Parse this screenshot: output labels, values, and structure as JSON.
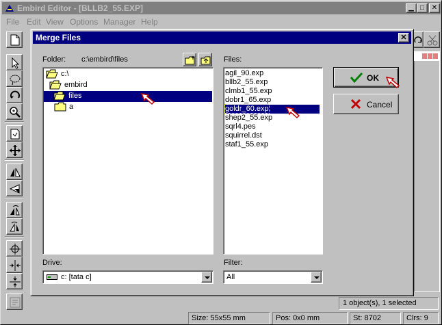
{
  "app": {
    "title": "Embird Editor - [BLLB2_55.EXP]",
    "menu": [
      "File",
      "Edit",
      "View",
      "Options",
      "Manager",
      "Help"
    ]
  },
  "status": {
    "selection": "1 object(s), 1 selected",
    "size": "Size: 55x55 mm",
    "pos": "Pos: 0x0 mm",
    "stitches": "St: 8702",
    "colors": "Clrs: 9"
  },
  "dialog": {
    "title": "Merge Files",
    "folder_label": "Folder:",
    "folder_path": "c:\\embird\\files",
    "files_label": "Files:",
    "drive_label": "Drive:",
    "filter_label": "Filter:",
    "folders": [
      {
        "name": "c:\\",
        "open": true,
        "selected": false
      },
      {
        "name": "embird",
        "open": true,
        "selected": false
      },
      {
        "name": "files",
        "open": true,
        "selected": true
      },
      {
        "name": "a",
        "open": false,
        "selected": false
      }
    ],
    "files": [
      "agil_90.exp",
      "bllb2_55.exp",
      "clmb1_55.exp",
      "dobr1_65.exp",
      "goldr_60.exp",
      "shep2_55.exp",
      "sqrl4.pes",
      "squirrel.dst",
      "staf1_55.exp"
    ],
    "selected_file": "goldr_60.exp",
    "drive_value": "c: [tata c]",
    "filter_value": "All",
    "ok_label": "OK",
    "cancel_label": "Cancel"
  },
  "colors": {
    "dialog_title_bg": "#000080",
    "selection_bg": "#000080",
    "inactive_title_bg": "#808080"
  }
}
